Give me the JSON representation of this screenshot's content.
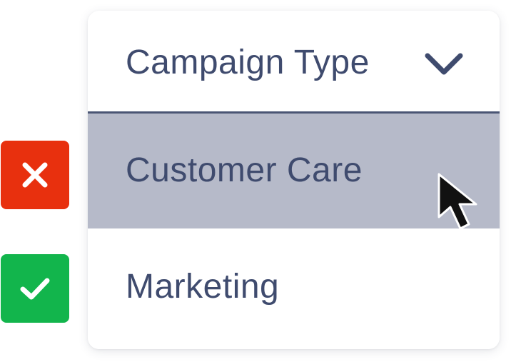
{
  "dropdown": {
    "header_label": "Campaign Type",
    "expanded": true,
    "toggle_icon": "chevron-down-icon",
    "options": [
      {
        "label": "Customer Care",
        "state": "hovered",
        "marker": "incorrect",
        "marker_icon": "close-icon"
      },
      {
        "label": "Marketing",
        "state": "default",
        "marker": "correct",
        "marker_icon": "check-icon"
      }
    ]
  },
  "pointer": "mouse-cursor-icon",
  "colors": {
    "text": "#3f4b6e",
    "header_divider": "#4a5574",
    "hover_background": "#b6bac9",
    "incorrect_badge": "#e8300e",
    "correct_badge": "#12b54c"
  }
}
